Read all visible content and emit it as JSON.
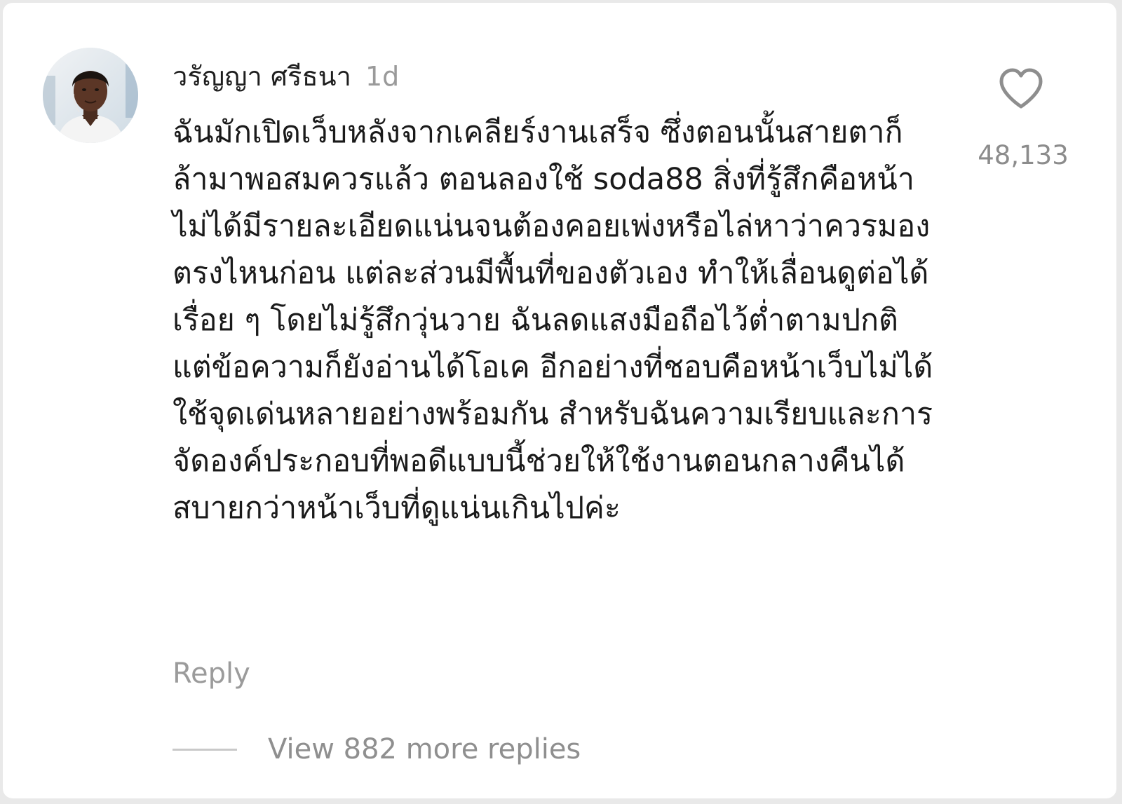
{
  "comment": {
    "username": "วรัญญา ศรีธนา",
    "age": "1d",
    "text": "ฉันมักเปิดเว็บหลังจากเคลียร์งานเสร็จ ซึ่งตอนนั้นสายตาก็ล้ามาพอสมควรแล้ว ตอนลองใช้ soda88 สิ่งที่รู้สึกคือหน้าไม่ได้มีรายละเอียดแน่นจนต้องคอยเพ่งหรือไล่หาว่าควรมองตรงไหนก่อน แต่ละส่วนมีพื้นที่ของตัวเอง ทำให้เลื่อนดูต่อได้เรื่อย ๆ โดยไม่รู้สึกวุ่นวาย ฉันลดแสงมือถือไว้ต่ำตามปกติ แต่ข้อความก็ยังอ่านได้โอเค อีกอย่างที่ชอบคือหน้าเว็บไม่ได้ใช้จุดเด่นหลายอย่างพร้อมกัน สำหรับฉันความเรียบและการจัดองค์ประกอบที่พอดีแบบนี้ช่วยให้ใช้งานตอนกลางคืนได้สบายกว่าหน้าเว็บที่ดูแน่นเกินไปค่ะ",
    "like_count": "48,133",
    "reply_label": "Reply",
    "view_replies_label": "View 882 more replies"
  },
  "icons": {
    "like": "heart-outline-icon"
  },
  "colors": {
    "background": "#ffffff",
    "text": "#1a1a1a",
    "muted": "#9b9b9b"
  }
}
